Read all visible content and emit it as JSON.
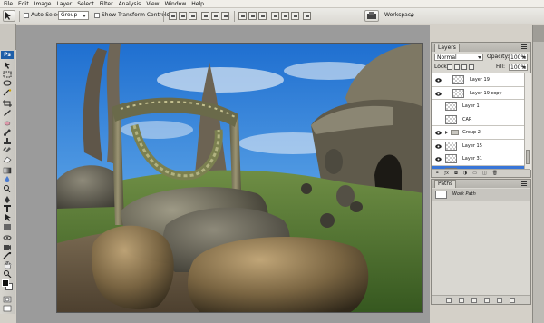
{
  "menu": [
    "File",
    "Edit",
    "Image",
    "Layer",
    "Select",
    "Filter",
    "Analysis",
    "View",
    "Window",
    "Help"
  ],
  "options": {
    "auto_select_label": "Auto-Select:",
    "auto_select_value": "Group",
    "show_transform_label": "Show Transform Controls",
    "workspace_label": "Workspace"
  },
  "tools": {
    "logo": "Ps"
  },
  "layers_panel": {
    "tab": "Layers",
    "blend_mode": "Normal",
    "opacity_label": "Opacity:",
    "opacity_value": "100%",
    "lock_label": "Lock:",
    "fill_label": "Fill:",
    "fill_value": "100%",
    "rows": [
      {
        "name": "Layer 19",
        "visible": true,
        "type": "layer"
      },
      {
        "name": "Layer 19 copy",
        "visible": true,
        "type": "layer"
      },
      {
        "name": "Layer 1",
        "visible": false,
        "type": "layer"
      },
      {
        "name": "CAR",
        "visible": false,
        "type": "layer"
      },
      {
        "name": "Group 2",
        "visible": true,
        "type": "group"
      },
      {
        "name": "Layer 15",
        "visible": true,
        "type": "layer"
      },
      {
        "name": "Layer 31",
        "visible": true,
        "type": "layer"
      },
      {
        "name": "Layer 34",
        "visible": true,
        "type": "layer",
        "selected": true
      }
    ]
  },
  "paths_panel": {
    "tab": "Paths",
    "path_name": "Work Path"
  },
  "colors": {
    "selection": "#3875d7",
    "sky": "#3b8de0",
    "grass": "#4f7a2c"
  }
}
